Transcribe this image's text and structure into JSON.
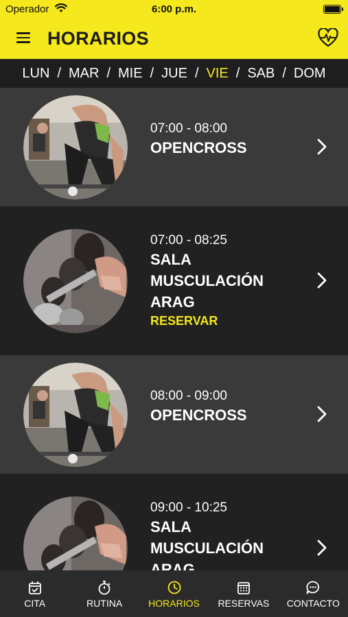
{
  "status_bar": {
    "carrier": "Operador",
    "time": "6:00 p.m."
  },
  "header": {
    "title": "HORARIOS",
    "menu_icon": "menu-icon",
    "action_icon": "heart-pulse-icon"
  },
  "days": {
    "items": [
      "LUN",
      "MAR",
      "MIE",
      "JUE",
      "VIE",
      "SAB",
      "DOM"
    ],
    "separator": "/",
    "active": "VIE",
    "active_color": "#f5e81c"
  },
  "schedule": [
    {
      "time": "07:00 - 08:00",
      "name": "OPENCROSS",
      "image": "deadlift-photo"
    },
    {
      "time": "07:00 - 08:25",
      "name": "SALA MUSCULACIÓN ARAG",
      "action": "RESERVAR",
      "image": "dumbbell-photo"
    },
    {
      "time": "08:00 - 09:00",
      "name": "OPENCROSS",
      "image": "deadlift-photo"
    },
    {
      "time": "09:00 - 10:25",
      "name": "SALA MUSCULACIÓN ARAG",
      "image": "dumbbell-photo"
    }
  ],
  "tabs": [
    {
      "label": "CITA",
      "icon": "calendar-check-icon"
    },
    {
      "label": "RUTINA",
      "icon": "stopwatch-icon"
    },
    {
      "label": "HORARIOS",
      "icon": "clock-icon",
      "active": true
    },
    {
      "label": "RESERVAS",
      "icon": "calendar-grid-icon"
    },
    {
      "label": "CONTACTO",
      "icon": "chat-bubble-icon"
    }
  ],
  "colors": {
    "accent": "#f5e81c",
    "row_light": "#3a3a3a",
    "row_dark": "#212121",
    "tab_bar": "#2b2b2b"
  }
}
